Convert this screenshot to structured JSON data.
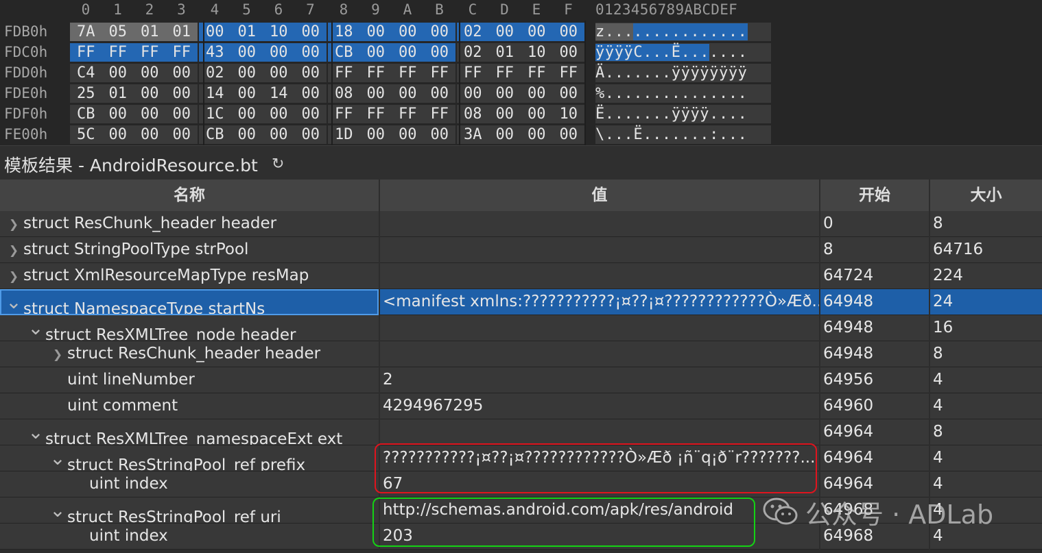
{
  "hex": {
    "columns": [
      "0",
      "1",
      "2",
      "3",
      "4",
      "5",
      "6",
      "7",
      "8",
      "9",
      "A",
      "B",
      "C",
      "D",
      "E",
      "F"
    ],
    "ascii_header": "0123456789ABCDEF",
    "rows": [
      {
        "addr": "FDB0h",
        "bytes": [
          "7A",
          "05",
          "01",
          "01",
          "00",
          "01",
          "10",
          "00",
          "18",
          "00",
          "00",
          "00",
          "02",
          "00",
          "00",
          "00"
        ],
        "ascii": "z..............."
      },
      {
        "addr": "FDC0h",
        "bytes": [
          "FF",
          "FF",
          "FF",
          "FF",
          "43",
          "00",
          "00",
          "00",
          "CB",
          "00",
          "00",
          "00",
          "02",
          "01",
          "10",
          "00"
        ],
        "ascii": "ÿÿÿÿC...Ë......."
      },
      {
        "addr": "FDD0h",
        "bytes": [
          "C4",
          "00",
          "00",
          "00",
          "02",
          "00",
          "00",
          "00",
          "FF",
          "FF",
          "FF",
          "FF",
          "FF",
          "FF",
          "FF",
          "FF"
        ],
        "ascii": "Ä.......ÿÿÿÿÿÿÿÿ"
      },
      {
        "addr": "FDE0h",
        "bytes": [
          "25",
          "01",
          "00",
          "00",
          "14",
          "00",
          "14",
          "00",
          "08",
          "00",
          "00",
          "00",
          "00",
          "00",
          "00",
          "00"
        ],
        "ascii": "%..............."
      },
      {
        "addr": "FDF0h",
        "bytes": [
          "CB",
          "00",
          "00",
          "00",
          "1C",
          "00",
          "00",
          "00",
          "FF",
          "FF",
          "FF",
          "FF",
          "08",
          "00",
          "00",
          "10"
        ],
        "ascii": "Ë.......ÿÿÿÿ...."
      },
      {
        "addr": "FE00h",
        "bytes": [
          "5C",
          "00",
          "00",
          "00",
          "CB",
          "00",
          "00",
          "00",
          "1D",
          "00",
          "00",
          "00",
          "3A",
          "00",
          "00",
          "00"
        ],
        "ascii": "\\...Ë.......:..."
      }
    ]
  },
  "template": {
    "title": "模板结果 - AndroidResource.bt",
    "refresh_icon": "↻"
  },
  "table": {
    "headers": {
      "name": "名称",
      "value": "值",
      "start": "开始",
      "size": "大小"
    },
    "rows": [
      {
        "indent": 0,
        "arrow": "right",
        "name": "struct ResChunk_header header",
        "value": "",
        "start": "0",
        "size": "8"
      },
      {
        "indent": 0,
        "arrow": "right",
        "name": "struct StringPoolType strPool",
        "value": "",
        "start": "8",
        "size": "64716"
      },
      {
        "indent": 0,
        "arrow": "right",
        "name": "struct XmlResourceMapType resMap",
        "value": "",
        "start": "64724",
        "size": "224"
      },
      {
        "indent": 0,
        "arrow": "down",
        "name": "struct NamespaceType startNs",
        "value": "<manifest xmlns:???????????¡¤??¡¤????????????Ò»Æð...",
        "start": "64948",
        "size": "24",
        "selected": true
      },
      {
        "indent": 1,
        "arrow": "down",
        "name": "struct ResXMLTree_node header",
        "value": "",
        "start": "64948",
        "size": "16"
      },
      {
        "indent": 2,
        "arrow": "right",
        "name": "struct ResChunk_header header",
        "value": "",
        "start": "64948",
        "size": "8"
      },
      {
        "indent": 2,
        "arrow": "",
        "name": "uint lineNumber",
        "value": "2",
        "start": "64956",
        "size": "4"
      },
      {
        "indent": 2,
        "arrow": "",
        "name": "uint comment",
        "value": "4294967295",
        "start": "64960",
        "size": "4"
      },
      {
        "indent": 1,
        "arrow": "down",
        "name": "struct ResXMLTree_namespaceExt ext",
        "value": "",
        "start": "64964",
        "size": "8"
      },
      {
        "indent": 2,
        "arrow": "down",
        "name": "struct ResStringPool_ref prefix",
        "value": "???????????¡¤??¡¤????????????Ò»Æð  ¡ñ¨q¡ð¨r???????...",
        "start": "64964",
        "size": "4"
      },
      {
        "indent": 3,
        "arrow": "",
        "name": "uint index",
        "value": "67",
        "start": "64964",
        "size": "4"
      },
      {
        "indent": 2,
        "arrow": "down",
        "name": "struct ResStringPool_ref uri",
        "value": "http://schemas.android.com/apk/res/android",
        "start": "64968",
        "size": "4"
      },
      {
        "indent": 3,
        "arrow": "",
        "name": "uint index",
        "value": "203",
        "start": "64968",
        "size": "4"
      }
    ]
  },
  "watermark": {
    "text": "公众号 · ADLab",
    "icon": "wechat-icon"
  },
  "colors": {
    "selection": "#1e5fa8",
    "red_box": "#e0141e",
    "green_box": "#14d214"
  }
}
